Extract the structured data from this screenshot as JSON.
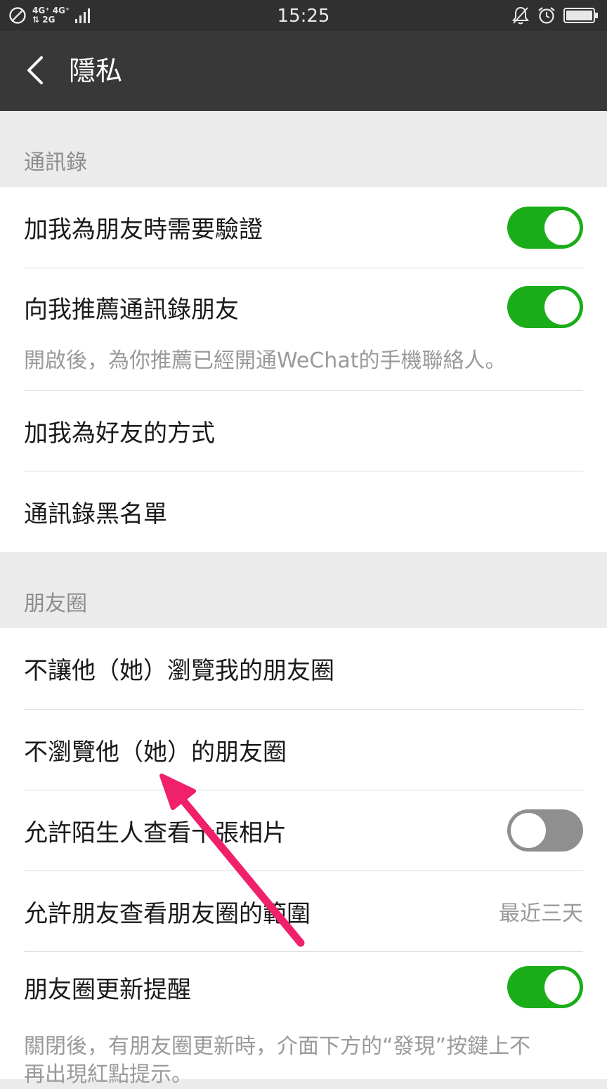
{
  "status_bar": {
    "network_top": "4G⁺ 4G⁺",
    "network_bottom": "⇅ 2G",
    "time": "15:25"
  },
  "nav": {
    "title": "隱私"
  },
  "sections": {
    "contacts": {
      "header": "通訊錄",
      "items": [
        {
          "label": "加我為朋友時需要驗證",
          "toggle": "on"
        },
        {
          "label": "向我推薦通訊錄朋友",
          "toggle": "on"
        },
        {
          "label": "加我為好友的方式"
        },
        {
          "label": "通訊錄黑名單"
        }
      ],
      "recommend_hint": "開啟後，為你推薦已經開通WeChat的手機聯絡人。"
    },
    "moments": {
      "header": "朋友圈",
      "items": [
        {
          "label": "不讓他（她）瀏覽我的朋友圈"
        },
        {
          "label": "不瀏覽他（她）的朋友圈"
        },
        {
          "label": "允許陌生人查看十張相片",
          "toggle": "off"
        },
        {
          "label": "允許朋友查看朋友圈的範圍",
          "value": "最近三天"
        },
        {
          "label": "朋友圈更新提醒",
          "toggle": "on"
        }
      ],
      "update_hint_line1": "關閉後，有朋友圈更新時，介面下方的“發現”按鍵上不",
      "update_hint_line2": "再出現紅點提示。"
    }
  },
  "colors": {
    "toggle_on": "#1aad19",
    "toggle_off": "#8f8f8f",
    "annotation_arrow": "#f0206a"
  }
}
